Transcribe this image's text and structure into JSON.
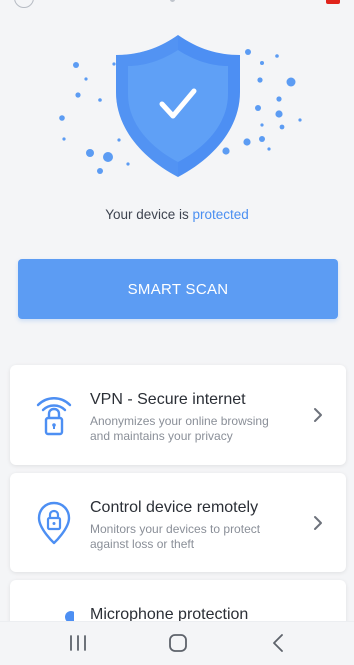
{
  "hero": {
    "status_prefix": "Your device is ",
    "status_word": "protected",
    "shield_color": "#4d8ff3",
    "dot_color": "#5c9cf3"
  },
  "actions": {
    "smart_scan_label": "SMART SCAN",
    "button_color": "#5c9cf3"
  },
  "features": [
    {
      "title": "VPN - Secure internet",
      "description": "Anonymizes your online browsing and maintains your privacy",
      "icon": "wifi-lock-icon"
    },
    {
      "title": "Control device remotely",
      "description": "Monitors your devices to protect against loss or theft",
      "icon": "location-lock-icon"
    },
    {
      "title": "Microphone protection",
      "description": "",
      "icon": "microphone-icon"
    }
  ],
  "system_nav": {
    "recents_icon": "recents-icon",
    "home_icon": "home-icon",
    "back_icon": "back-icon"
  }
}
